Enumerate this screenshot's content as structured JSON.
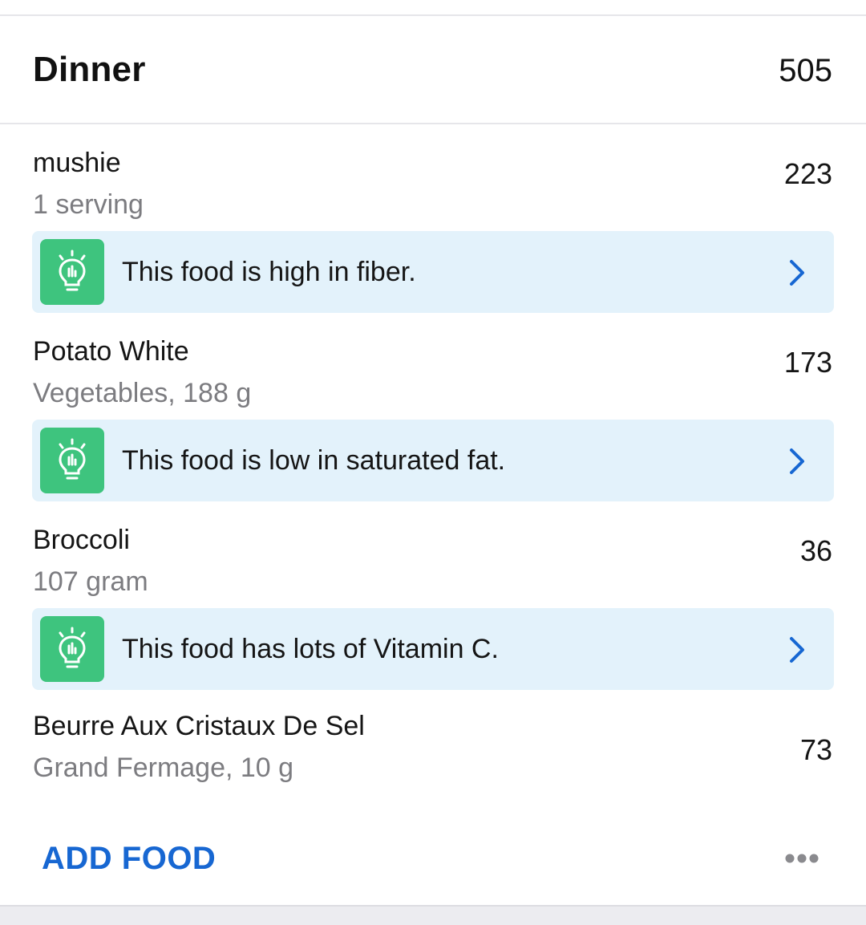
{
  "meal": {
    "title": "Dinner",
    "total_calories": "505"
  },
  "foods": [
    {
      "name": "mushie",
      "detail": "1 serving",
      "calories": "223",
      "insight": {
        "text": "This food is high in fiber.",
        "icon": "lightbulb-icon"
      }
    },
    {
      "name": "Potato White",
      "detail": "Vegetables, 188 g",
      "calories": "173",
      "insight": {
        "text": "This food is low in saturated fat.",
        "icon": "lightbulb-icon"
      }
    },
    {
      "name": "Broccoli",
      "detail": "107 gram",
      "calories": "36",
      "insight": {
        "text": "This food has lots of Vitamin C.",
        "icon": "lightbulb-icon"
      }
    },
    {
      "name": "Beurre Aux Cristaux De Sel",
      "detail": "Grand Fermage, 10 g",
      "calories": "73"
    }
  ],
  "footer": {
    "add_food_label": "ADD FOOD",
    "more_icon": "more-horizontal-icon"
  },
  "colors": {
    "accent": "#1767d2",
    "insight_bg": "#e3f2fb",
    "insight_icon_bg": "#3ec47e",
    "secondary_text": "#7c7c80"
  }
}
